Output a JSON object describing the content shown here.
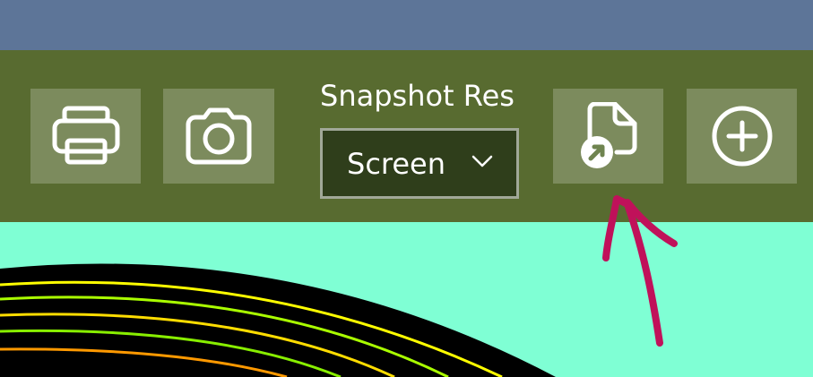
{
  "colors": {
    "title_strip": "#5d7598",
    "toolbar_bg": "#586b30",
    "canvas_bg": "#7fffd4",
    "dropdown_bg": "#2f3e1b",
    "icon_stroke": "#ffffff",
    "annotation": "#c0115a"
  },
  "toolbar": {
    "buttons": [
      {
        "icon": "printer-icon"
      },
      {
        "icon": "camera-icon"
      },
      {
        "icon": "export-file-icon"
      },
      {
        "icon": "add-circle-icon"
      }
    ],
    "snapshot_res": {
      "label": "Snapshot Res",
      "selected": "Screen",
      "chevron_icon": "chevron-down-icon"
    }
  },
  "annotation": {
    "shape": "hand-drawn-arrow"
  },
  "canvas": {
    "arc_colors": [
      "#ffff00",
      "#aaff00",
      "#ffdd00",
      "#88ee00",
      "#ff9900"
    ]
  }
}
